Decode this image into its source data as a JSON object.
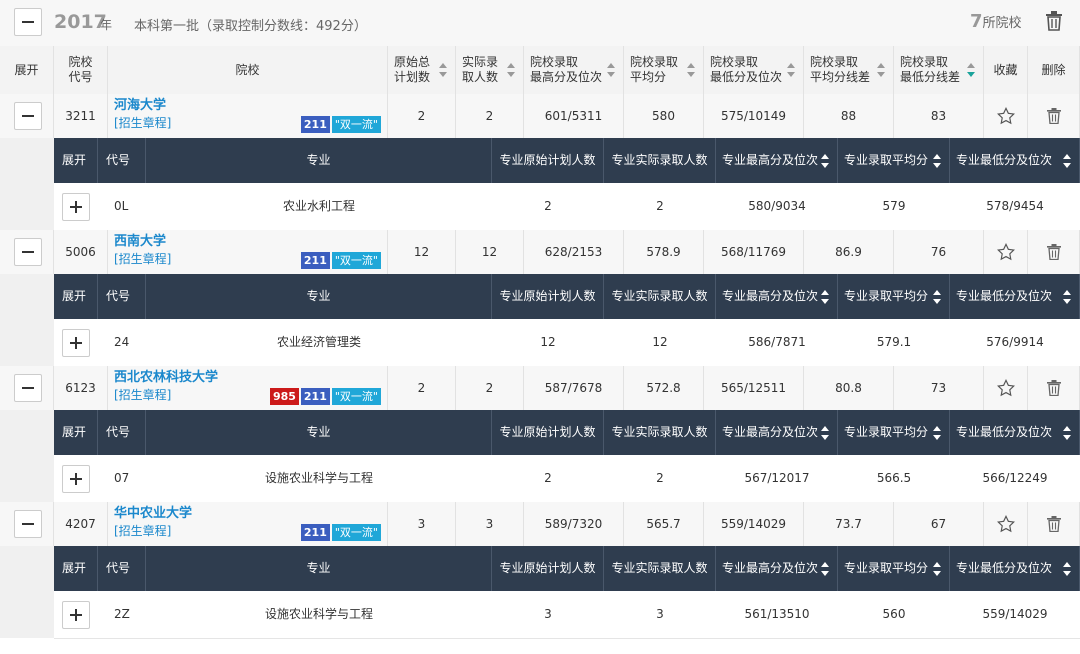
{
  "top": {
    "year": "2017",
    "year_suffix": "年",
    "batch": "本科第一批（录取控制分数线：492分）",
    "count_num": "7",
    "count_suffix": "所院校"
  },
  "headers": {
    "expand": "展开",
    "code": "院校\n代号",
    "school": "院校",
    "plan": "原始总\n计划数",
    "admit": "实际录\n取人数",
    "max": "院校录取\n最高分及位次",
    "avg": "院校录取\n平均分",
    "min": "院校录取\n最低分及位次",
    "avgdiff": "院校录取\n平均分线差",
    "mindiff": "院校录取\n最低分线差",
    "fav": "收藏",
    "del": "删除"
  },
  "major_headers": {
    "expand": "展开",
    "code": "代号",
    "major": "专业",
    "plan": "专业原始计划人数",
    "admit": "专业实际录取人数",
    "max": "专业最高分及位次",
    "avg": "专业录取平均分",
    "min": "专业最低分及位次"
  },
  "schools": [
    {
      "code": "3211",
      "name": "河海大学",
      "rule": "[招生章程]",
      "badges": [
        "211",
        "\"双一流\""
      ],
      "plan": "2",
      "admit": "2",
      "max": "601/5311",
      "avg": "580",
      "min": "575/10149",
      "avgdiff": "88",
      "mindiff": "83",
      "major": {
        "code": "0L",
        "name": "农业水利工程",
        "plan": "2",
        "admit": "2",
        "max": "580/9034",
        "avg": "579",
        "min": "578/9454"
      }
    },
    {
      "code": "5006",
      "name": "西南大学",
      "rule": "[招生章程]",
      "badges": [
        "211",
        "\"双一流\""
      ],
      "plan": "12",
      "admit": "12",
      "max": "628/2153",
      "avg": "578.9",
      "min": "568/11769",
      "avgdiff": "86.9",
      "mindiff": "76",
      "major": {
        "code": "24",
        "name": "农业经济管理类",
        "plan": "12",
        "admit": "12",
        "max": "586/7871",
        "avg": "579.1",
        "min": "576/9914"
      }
    },
    {
      "code": "6123",
      "name": "西北农林科技大学",
      "rule": "[招生章程]",
      "badges": [
        "985",
        "211",
        "\"双一流\""
      ],
      "plan": "2",
      "admit": "2",
      "max": "587/7678",
      "avg": "572.8",
      "min": "565/12511",
      "avgdiff": "80.8",
      "mindiff": "73",
      "major": {
        "code": "07",
        "name": "设施农业科学与工程",
        "plan": "2",
        "admit": "2",
        "max": "567/12017",
        "avg": "566.5",
        "min": "566/12249"
      }
    },
    {
      "code": "4207",
      "name": "华中农业大学",
      "rule": "[招生章程]",
      "badges": [
        "211",
        "\"双一流\""
      ],
      "plan": "3",
      "admit": "3",
      "max": "589/7320",
      "avg": "565.7",
      "min": "559/14029",
      "avgdiff": "73.7",
      "mindiff": "67",
      "major": {
        "code": "2Z",
        "name": "设施农业科学与工程",
        "plan": "3",
        "admit": "3",
        "max": "561/13510",
        "avg": "560",
        "min": "559/14029"
      }
    }
  ],
  "colors": {
    "link": "#1b88cc",
    "header_dark": "#2f3d4f",
    "badge_985": "#cc1a1a",
    "badge_211": "#3b5ebf",
    "badge_syl": "#20a7d8",
    "sort_active": "#1aa39b"
  }
}
